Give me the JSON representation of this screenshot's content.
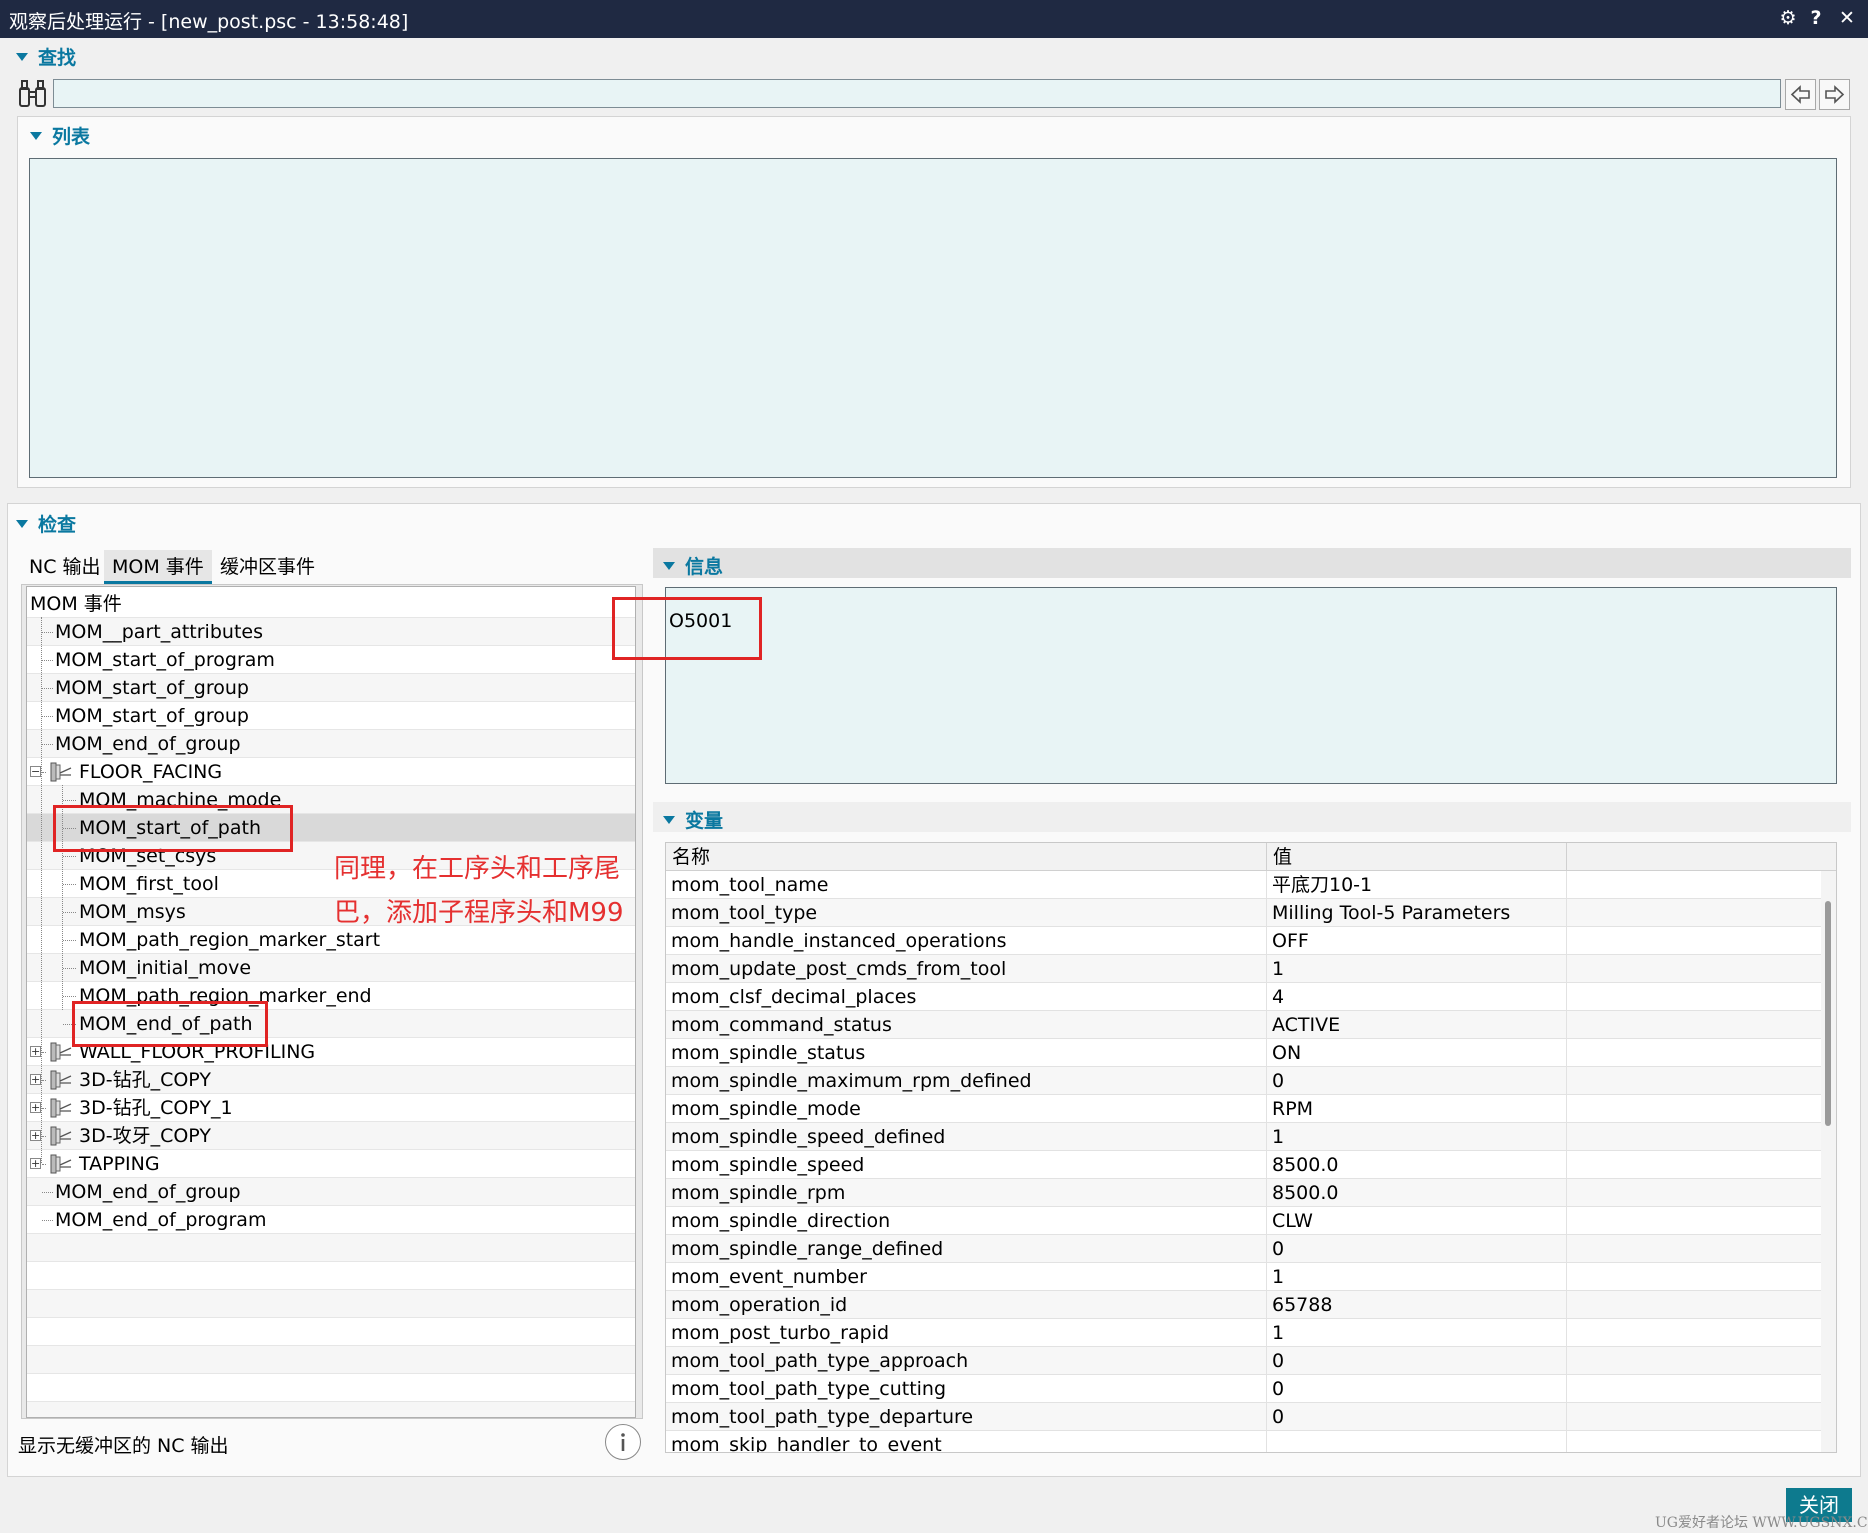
{
  "window": {
    "title": "观察后处理运行 - [new_post.psc - 13:58:48]",
    "buttons": {
      "settings": "⚙",
      "help": "?",
      "close": "✕"
    }
  },
  "find": {
    "label": "查找",
    "input_value": "",
    "icons": {
      "search": "binoculars-icon",
      "back": "arrow-left-icon",
      "forward": "arrow-right-icon"
    }
  },
  "list": {
    "label": "列表"
  },
  "inspect": {
    "label": "检查",
    "tabs": [
      "NC 输出",
      "MOM 事件",
      "缓冲区事件"
    ],
    "active_tab": "MOM 事件",
    "tree": [
      {
        "label": "MOM 事件",
        "level": 0
      },
      {
        "label": "MOM__part_attributes",
        "level": 1
      },
      {
        "label": "MOM_start_of_program",
        "level": 1
      },
      {
        "label": "MOM_start_of_group",
        "level": 1
      },
      {
        "label": "MOM_start_of_group",
        "level": 1
      },
      {
        "label": "MOM_end_of_group",
        "level": 1
      },
      {
        "label": "FLOOR_FACING",
        "level": 1,
        "operation": true,
        "expanded": true
      },
      {
        "label": "MOM_machine_mode",
        "level": 2
      },
      {
        "label": "MOM_start_of_path",
        "level": 2,
        "selected": true
      },
      {
        "label": "MOM_set_csys",
        "level": 2
      },
      {
        "label": "MOM_first_tool",
        "level": 2
      },
      {
        "label": "MOM_msys",
        "level": 2
      },
      {
        "label": "MOM_path_region_marker_start",
        "level": 2
      },
      {
        "label": "MOM_initial_move",
        "level": 2
      },
      {
        "label": "MOM_path_region_marker_end",
        "level": 2
      },
      {
        "label": "MOM_end_of_path",
        "level": 2
      },
      {
        "label": "WALL_FLOOR_PROFILING",
        "level": 1,
        "operation": true,
        "expanded": false
      },
      {
        "label": "3D-钻孔_COPY",
        "level": 1,
        "operation": true,
        "expanded": false
      },
      {
        "label": "3D-钻孔_COPY_1",
        "level": 1,
        "operation": true,
        "expanded": false
      },
      {
        "label": "3D-攻牙_COPY",
        "level": 1,
        "operation": true,
        "expanded": false
      },
      {
        "label": "TAPPING",
        "level": 1,
        "operation": true,
        "expanded": false
      },
      {
        "label": "MOM_end_of_group",
        "level": 1
      },
      {
        "label": "MOM_end_of_program",
        "level": 1
      }
    ],
    "footer_label": "显示无缓冲区的 NC 输出",
    "info_icon": "info-icon"
  },
  "info": {
    "label": "信息",
    "text": "O5001"
  },
  "variables": {
    "label": "变量",
    "columns": [
      "名称",
      "值"
    ],
    "rows": [
      [
        "mom_tool_name",
        "平底刀10-1"
      ],
      [
        "mom_tool_type",
        "Milling Tool-5 Parameters"
      ],
      [
        "mom_handle_instanced_operations",
        "OFF"
      ],
      [
        "mom_update_post_cmds_from_tool",
        "1"
      ],
      [
        "mom_clsf_decimal_places",
        "4"
      ],
      [
        "mom_command_status",
        "ACTIVE"
      ],
      [
        "mom_spindle_status",
        "ON"
      ],
      [
        "mom_spindle_maximum_rpm_defined",
        "0"
      ],
      [
        "mom_spindle_mode",
        "RPM"
      ],
      [
        "mom_spindle_speed_defined",
        "1"
      ],
      [
        "mom_spindle_speed",
        "8500.0"
      ],
      [
        "mom_spindle_rpm",
        "8500.0"
      ],
      [
        "mom_spindle_direction",
        "CLW"
      ],
      [
        "mom_spindle_range_defined",
        "0"
      ],
      [
        "mom_event_number",
        "1"
      ],
      [
        "mom_operation_id",
        "65788"
      ],
      [
        "mom_post_turbo_rapid",
        "1"
      ],
      [
        "mom_tool_path_type_approach",
        "0"
      ],
      [
        "mom_tool_path_type_cutting",
        "0"
      ],
      [
        "mom_tool_path_type_departure",
        "0"
      ],
      [
        "mom_skip_handler_to_event",
        ""
      ]
    ]
  },
  "annotation": {
    "line1": "同理，在工序头和工序尾",
    "line2": "巴，添加子程序头和M99"
  },
  "close_button": "关闭",
  "watermark": "UG爱好者论坛 WWW.UGSNX.COM",
  "colors": {
    "accent": "#0a78a0",
    "titlebar": "#1f2942",
    "field_bg": "#e8f4f5",
    "annotation_red": "#e53030",
    "close_bg": "#0d7a8e"
  }
}
